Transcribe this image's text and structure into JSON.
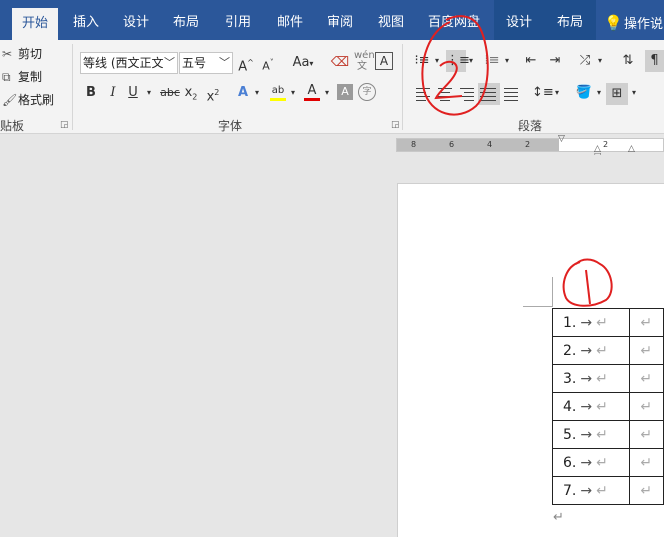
{
  "tabs": [
    "开始",
    "插入",
    "设计",
    "布局",
    "引用",
    "邮件",
    "审阅",
    "视图",
    "百度网盘",
    "设计",
    "布局"
  ],
  "tell_me": "操作说",
  "clipboard": {
    "cut": "剪切",
    "copy": "复制",
    "format_painter": "格式刷",
    "group_label": "贴板"
  },
  "font": {
    "name": "等线 (西文正文",
    "size": "五号",
    "change_case": "Aa",
    "group_label": "字体",
    "pinyin": "wén\n文",
    "border_char": "A",
    "enclose_char": "字"
  },
  "paragraph": {
    "group_label": "段落"
  },
  "ruler": {
    "ticks": [
      "8",
      "6",
      "4",
      "2",
      "2"
    ]
  },
  "colors": {
    "ribbon_blue": "#2b579a",
    "font_red": "#e00000",
    "highlight_yellow": "#ffff00",
    "annotation_red": "#e02020"
  },
  "annotations": [
    "1",
    "2"
  ],
  "table": {
    "rows": [
      {
        "num": "1.",
        "arrow": "→",
        "mark": "↵",
        "mark2": "↵"
      },
      {
        "num": "2.",
        "arrow": "→",
        "mark": "↵",
        "mark2": "↵"
      },
      {
        "num": "3.",
        "arrow": "→",
        "mark": "↵",
        "mark2": "↵"
      },
      {
        "num": "4.",
        "arrow": "→",
        "mark": "↵",
        "mark2": "↵"
      },
      {
        "num": "5.",
        "arrow": "→",
        "mark": "↵",
        "mark2": "↵"
      },
      {
        "num": "6.",
        "arrow": "→",
        "mark": "↵",
        "mark2": "↵"
      },
      {
        "num": "7.",
        "arrow": "→",
        "mark": "↵",
        "mark2": "↵"
      }
    ],
    "end_mark": "↵"
  }
}
